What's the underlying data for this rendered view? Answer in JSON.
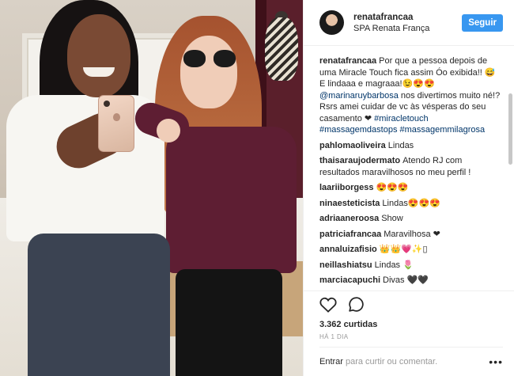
{
  "post": {
    "username": "renatafrancaa",
    "location": "SPA Renata França",
    "follow_label": "Seguir",
    "caption_user": "renatafrancaa",
    "caption_text": "Por que a pessoa depois de uma Miracle Touch fica assim Óo exibida!! 😅 E lindaaa e magraaa!😉😍😍",
    "caption_mention": "@marinaruybarbosa",
    "caption_rest": " nos divertimos muito né!? Rsrs amei cuidar de vc às vésperas do seu casamento ❤ ",
    "caption_tag1": "#miracletouch",
    "caption_tag2": "#massagemdastops",
    "caption_tag3": "#massagemmilagrosa",
    "comments": [
      {
        "user": "pahlomaoliveira",
        "text": "Lindas"
      },
      {
        "user": "thaisaraujodermato",
        "text": "Atendo RJ com resultados maravilhosos no meu perfil !"
      },
      {
        "user": "laariiborgess",
        "text": "😍😍😍"
      },
      {
        "user": "ninaesteticista",
        "text": "Lindas😍😍😍"
      },
      {
        "user": "adriaaneroosa",
        "text": "Show"
      },
      {
        "user": "patriciafrancaa",
        "text": "Maravilhosa ❤"
      },
      {
        "user": "annaluizafisio",
        "text": "👑👑💗✨▯"
      },
      {
        "user": "neillashiatsu",
        "text": "Lindas 🌷"
      },
      {
        "user": "marciacapuchi",
        "text": "Divas 🖤🖤"
      }
    ],
    "likes": "3.362 curtidas",
    "timestamp": "HÁ 1 DIA",
    "add_comment_link": "Entrar",
    "add_comment_hint": "para curtir ou comentar.",
    "more_options": "•••"
  },
  "icons": {
    "like": "heart-icon",
    "comment": "comment-bubble-icon",
    "more": "more-options-icon"
  },
  "colors": {
    "follow_button": "#3897f0",
    "link": "#003569"
  }
}
